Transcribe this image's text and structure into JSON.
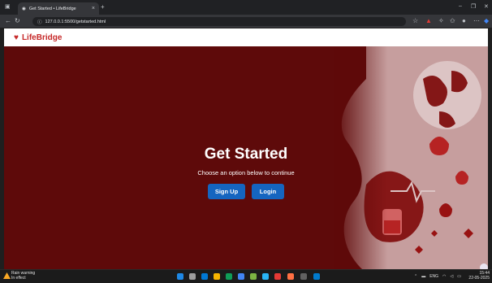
{
  "browser": {
    "tab_title": "Get Started • LifeBridge",
    "url": "127.0.0.1:5500/getstarted.html",
    "new_tab": "+",
    "close_tab": "×"
  },
  "site": {
    "brand": "LifeBridge",
    "brand_color": "#c62828"
  },
  "hero": {
    "title": "Get Started",
    "subtitle": "Choose an option below to continue",
    "signup_label": "Sign Up",
    "login_label": "Login",
    "background": "#5e0a0a",
    "button_color": "#1565c0"
  },
  "taskbar": {
    "weather_title": "Rain warning",
    "weather_sub": "In effect",
    "lang": "ENG",
    "time": "15:44",
    "date": "22-05-2025"
  }
}
